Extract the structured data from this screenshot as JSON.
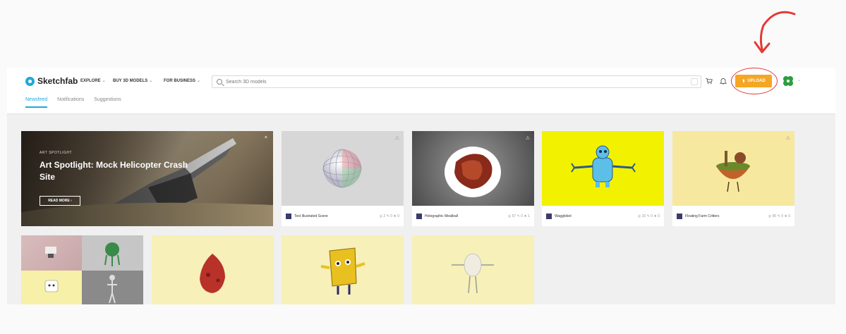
{
  "header": {
    "logo_text": "Sketchfab",
    "nav": [
      {
        "label": "EXPLORE"
      },
      {
        "label": "BUY 3D MODELS"
      },
      {
        "label": "FOR BUSINESS"
      }
    ],
    "search_placeholder": "Search 3D models",
    "upload_label": "UPLOAD",
    "tabs": [
      {
        "label": "Newsfeed",
        "active": true
      },
      {
        "label": "Notifications",
        "active": false
      },
      {
        "label": "Suggestions",
        "active": false
      }
    ]
  },
  "spotlight": {
    "kicker": "ART SPOTLIGHT",
    "title": "Art Spotlight: Mock Helicopter Crash Site",
    "button": "READ MORE",
    "close": "×"
  },
  "cards": [
    {
      "name": "Test Illustrated Scene",
      "stats": "◎ 2  ✎ 0  ★ 0",
      "bg": "#d7d7d7"
    },
    {
      "name": "Holographic Meatball",
      "stats": "◎ 57  ✎ 0  ★ 1",
      "bg": "#6a6a6a"
    },
    {
      "name": "Wagglebot",
      "stats": "◎ 15  ✎ 0  ★ 0",
      "bg": "#f2f200"
    },
    {
      "name": "Floating Farm Critters",
      "stats": "◎ 90  ✎ 0  ★ 0",
      "bg": "#f7e8a0"
    }
  ],
  "colors": {
    "accent": "#1caad9",
    "upload": "#f5a623",
    "annotation": "#e53935"
  }
}
